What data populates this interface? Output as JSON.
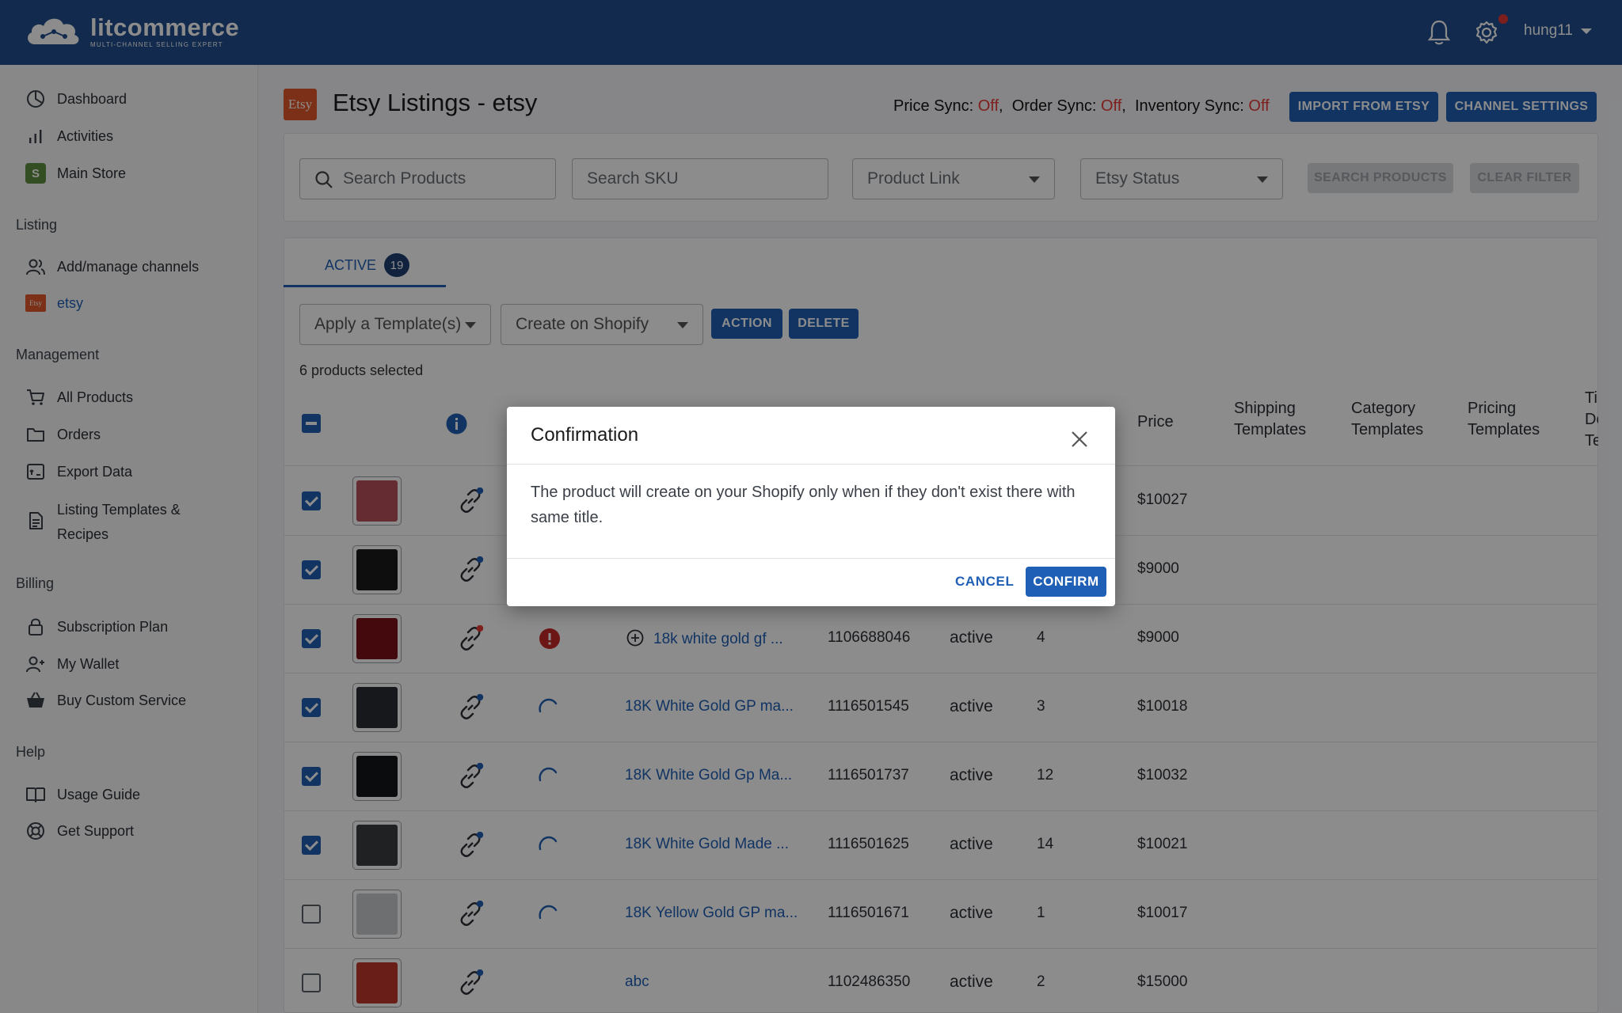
{
  "header": {
    "logo_name": "litcommerce",
    "logo_tagline": "MULTI-CHANNEL SELLING EXPERT",
    "username": "hung11",
    "icons": [
      "bell-icon",
      "gear-icon"
    ]
  },
  "sidebar": {
    "items_top": [
      {
        "label": "Dashboard",
        "icon": "dashboard-icon"
      },
      {
        "label": "Activities",
        "icon": "bar-chart-icon"
      },
      {
        "label": "Main Store",
        "icon": "shopify-icon"
      }
    ],
    "sections": {
      "listing": "Listing",
      "management": "Management",
      "billing": "Billing",
      "help": "Help"
    },
    "listing_items": [
      {
        "label": "Add/manage channels",
        "icon": "users-icon"
      },
      {
        "label": "etsy",
        "icon": "etsy-icon",
        "badge": "Etsy"
      }
    ],
    "management_items": [
      {
        "label": "All Products",
        "icon": "cart-icon"
      },
      {
        "label": "Orders",
        "icon": "folder-icon"
      },
      {
        "label": "Export Data",
        "icon": "export-icon"
      },
      {
        "label": "Listing Templates &",
        "label2": "Recipes",
        "icon": "document-icon"
      }
    ],
    "billing_items": [
      {
        "label": "Subscription Plan",
        "icon": "lock-icon"
      },
      {
        "label": "My Wallet",
        "icon": "add-user-icon"
      },
      {
        "label": "Buy Custom Service",
        "icon": "basket-icon"
      }
    ],
    "help_items": [
      {
        "label": "Usage Guide",
        "icon": "book-icon"
      },
      {
        "label": "Get Support",
        "icon": "lifebuoy-icon"
      }
    ]
  },
  "page": {
    "logo": "Etsy",
    "title": "Etsy Listings - etsy",
    "sync": {
      "price_label": "Price Sync",
      "price_value": "Off",
      "order_label": "Order Sync",
      "order_value": "Off",
      "inventory_label": "Inventory Sync",
      "inventory_value": "Off"
    },
    "import_button": "IMPORT FROM ETSY",
    "channel_settings_button": "CHANNEL SETTINGS"
  },
  "filters": {
    "search_products_placeholder": "Search Products",
    "search_sku_placeholder": "Search SKU",
    "product_link_select": "Product Link",
    "etsy_status_select": "Etsy Status",
    "search_button": "SEARCH PRODUCTS",
    "clear_button": "CLEAR FILTER"
  },
  "tabs": {
    "active_label": "ACTIVE",
    "active_count": "19"
  },
  "actions": {
    "template_select": "Apply a Template(s)",
    "create_select": "Create on Shopify",
    "action_button": "ACTION",
    "delete_button": "DELETE",
    "selected_text": "6 products selected"
  },
  "table": {
    "headers": {
      "price": "Price",
      "shipping_1": "Shipping",
      "shipping_2": "Templates",
      "category_1": "Category",
      "category_2": "Templates",
      "pricing_1": "Pricing",
      "pricing_2": "Templates",
      "title_1": "Ti",
      "title_2": "De",
      "title_3": "Te"
    },
    "rows": [
      {
        "checked": true,
        "title": "",
        "id": "",
        "status": "",
        "qty": "",
        "price": "$10027",
        "thumb_color": "#b9515a",
        "link_dot": "blue",
        "state": "none"
      },
      {
        "checked": true,
        "title": "",
        "id": "",
        "status": "",
        "qty": "",
        "price": "$9000",
        "thumb_color": "#1b1b1b",
        "link_dot": "blue",
        "state": "none"
      },
      {
        "checked": true,
        "title": "18k white gold gf ...",
        "id": "1106688046",
        "status": "active",
        "qty": "4",
        "price": "$9000",
        "thumb_color": "#7a1218",
        "link_dot": "red",
        "state": "error"
      },
      {
        "checked": true,
        "title": "18K White Gold GP ma...",
        "id": "1116501545",
        "status": "active",
        "qty": "3",
        "price": "$10018",
        "thumb_color": "#2a2d33",
        "link_dot": "blue",
        "state": "loading"
      },
      {
        "checked": true,
        "title": "18K White Gold Gp Ma...",
        "id": "1116501737",
        "status": "active",
        "qty": "12",
        "price": "$10032",
        "thumb_color": "#15171b",
        "link_dot": "blue",
        "state": "loading"
      },
      {
        "checked": true,
        "title": "18K White Gold Made ...",
        "id": "1116501625",
        "status": "active",
        "qty": "14",
        "price": "$10021",
        "thumb_color": "#3b3d40",
        "link_dot": "blue",
        "state": "loading"
      },
      {
        "checked": false,
        "title": "18K Yellow Gold GP ma...",
        "id": "1116501671",
        "status": "active",
        "qty": "1",
        "price": "$10017",
        "thumb_color": "#c9cbcd",
        "link_dot": "blue",
        "state": "loading"
      },
      {
        "checked": false,
        "title": "abc",
        "id": "1102486350",
        "status": "active",
        "qty": "2",
        "price": "$15000",
        "thumb_color": "#c0392b",
        "link_dot": "blue",
        "state": "none"
      }
    ]
  },
  "modal": {
    "title": "Confirmation",
    "body": "The product will create on your Shopify only when if they don't exist there with same title.",
    "cancel": "CANCEL",
    "confirm": "CONFIRM"
  },
  "colors": {
    "header_bg": "#1f4e8c",
    "accent": "#1f5fb5",
    "off_red": "#e53935",
    "etsy_orange": "#e1582b"
  }
}
